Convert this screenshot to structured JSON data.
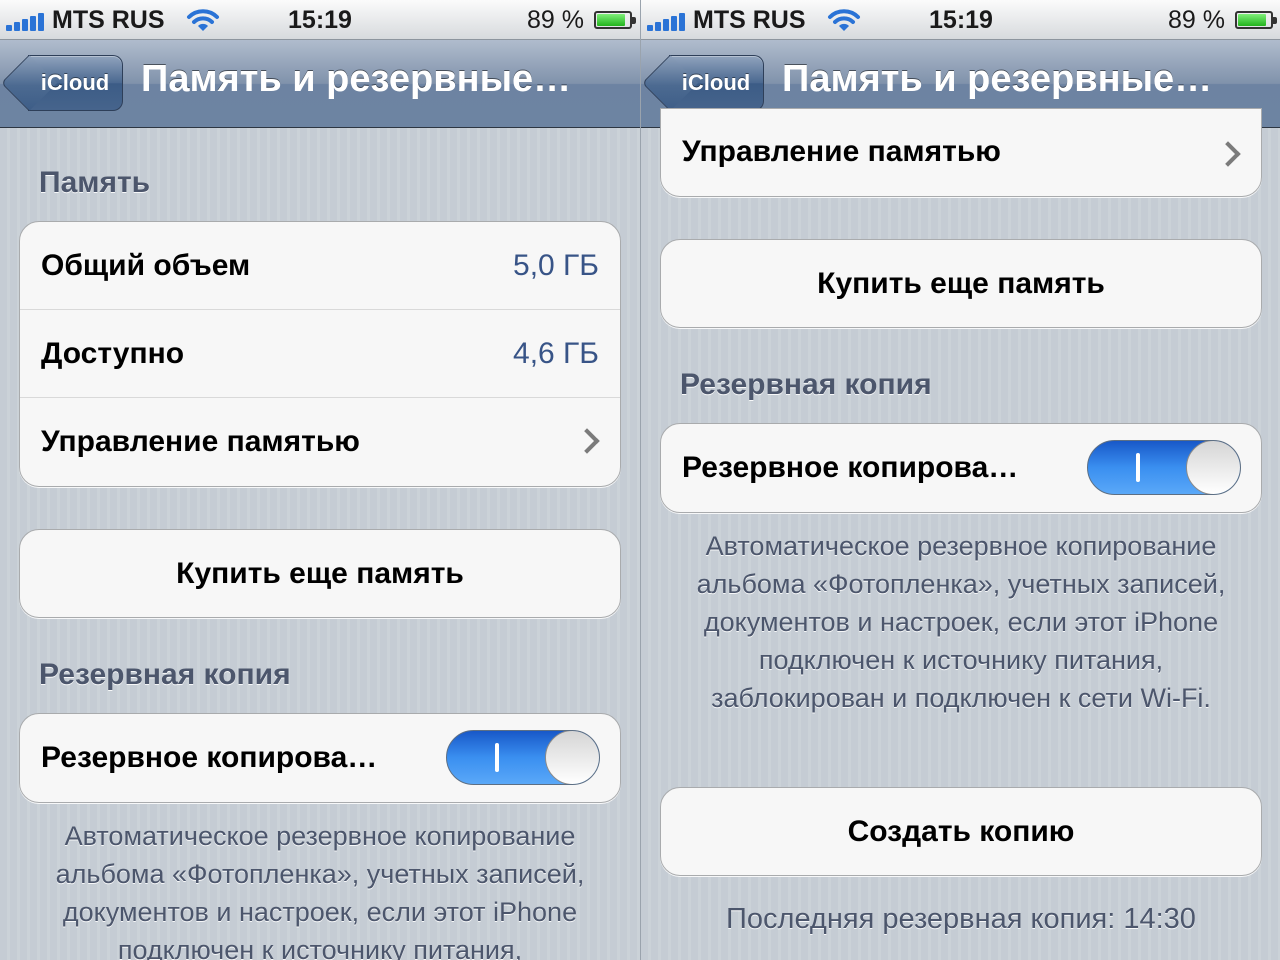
{
  "status": {
    "carrier": "MTS RUS",
    "time": "15:19",
    "battery_percent": "89 %",
    "battery_level": 0.89,
    "signal_bars": 5
  },
  "nav": {
    "back_label": "iCloud",
    "title": "Память и резервные…"
  },
  "storage": {
    "header": "Память",
    "total_label": "Общий объем",
    "total_value": "5,0 ГБ",
    "available_label": "Доступно",
    "available_value": "4,6 ГБ",
    "manage_label": "Управление памятью"
  },
  "buy_more_label": "Купить еще память",
  "backup": {
    "header": "Резервная копия",
    "toggle_label": "Резервное копирова…",
    "toggle_on": true,
    "description": "Автоматическое резервное копирование альбома «Фотопленка», учетных записей, документов и настроек, если этот iPhone подключен к источнику питания, заблокирован и подключен к сети Wi-Fi.",
    "create_label": "Создать копию",
    "last_backup": "Последняя резервная копия: 14:30"
  },
  "colors": {
    "value_text": "#385487",
    "section_text": "#4c566c",
    "toggle_on": "#2f7fe6"
  },
  "icons": {
    "signal": "signal-bars-icon",
    "wifi": "wifi-icon",
    "battery": "battery-icon",
    "chevron": "chevron-right-icon"
  }
}
